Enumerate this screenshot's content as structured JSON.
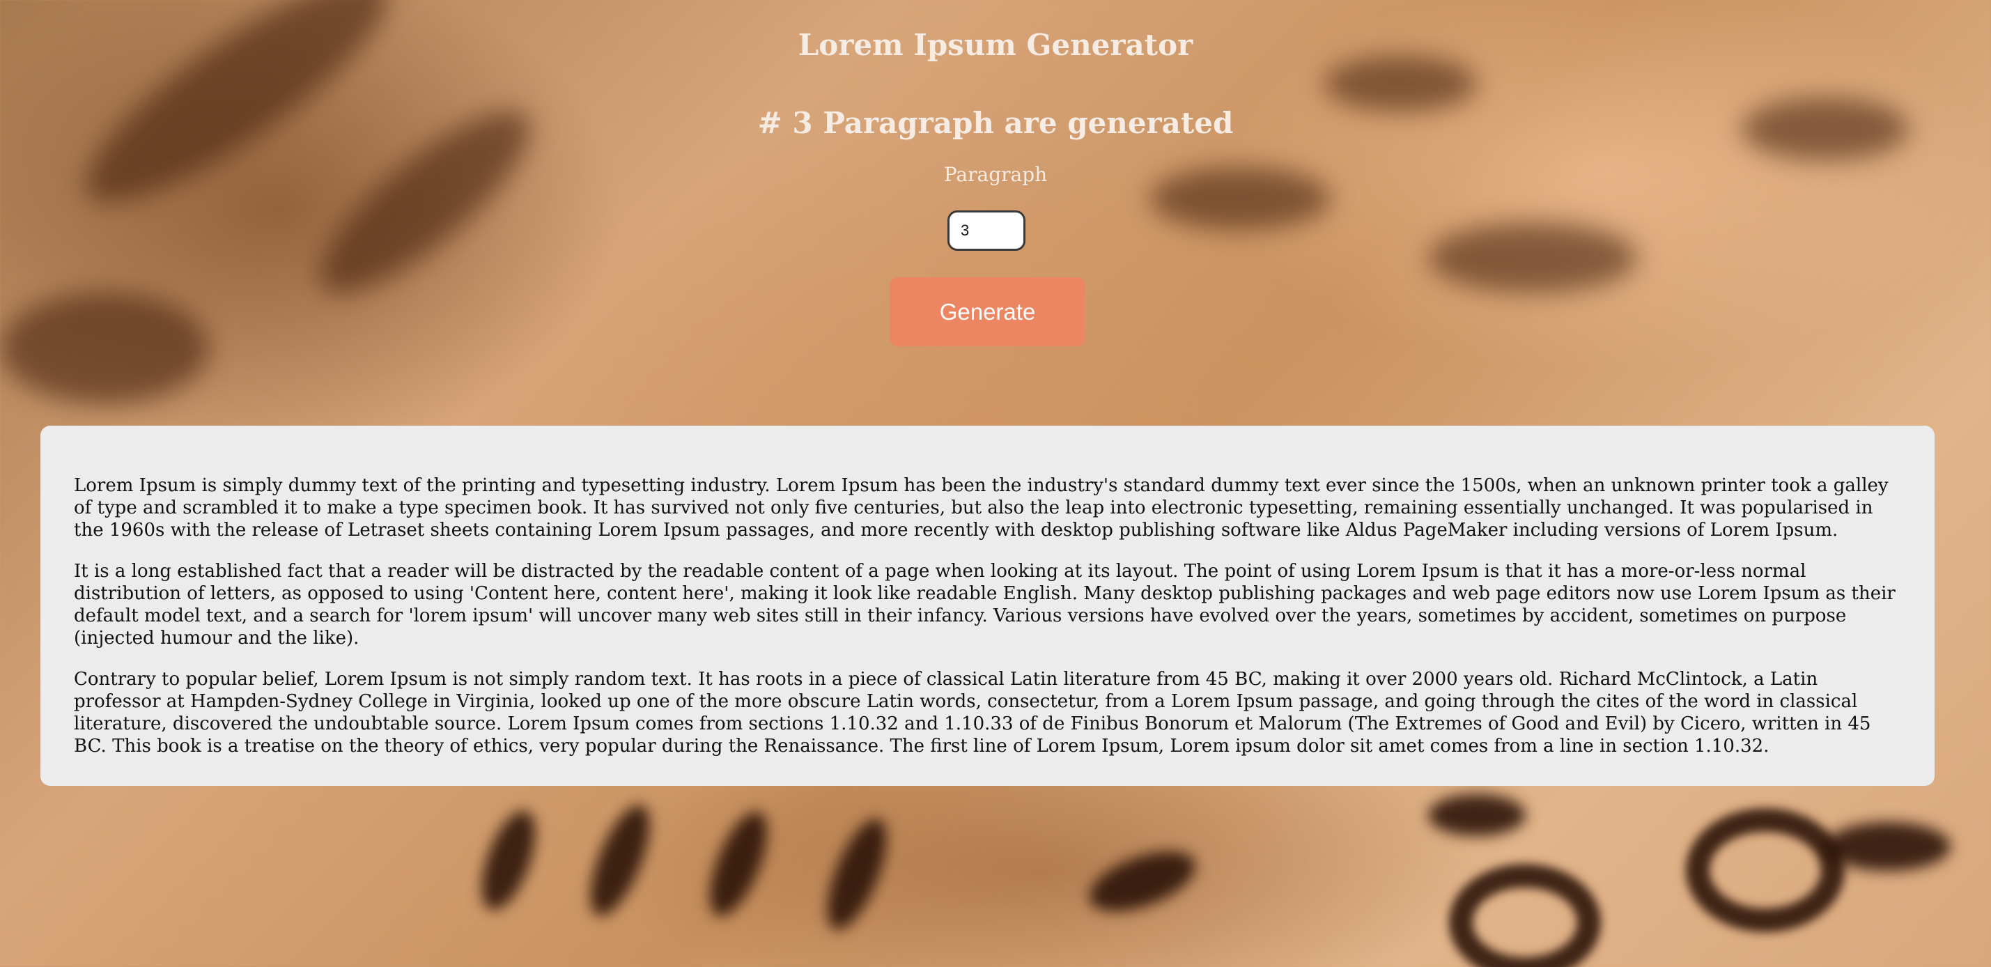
{
  "header": {
    "title": "Lorem Ipsum Generator",
    "status": "# 3 Paragraph are generated"
  },
  "form": {
    "label": "Paragraph",
    "count_value": "3",
    "generate_label": "Generate"
  },
  "output": {
    "paragraphs": [
      "Lorem Ipsum is simply dummy text of the printing and typesetting industry. Lorem Ipsum has been the industry's standard dummy text ever since the 1500s, when an unknown printer took a galley of type and scrambled it to make a type specimen book. It has survived not only five centuries, but also the leap into electronic typesetting, remaining essentially unchanged. It was popularised in the 1960s with the release of Letraset sheets containing Lorem Ipsum passages, and more recently with desktop publishing software like Aldus PageMaker including versions of Lorem Ipsum.",
      "It is a long established fact that a reader will be distracted by the readable content of a page when looking at its layout. The point of using Lorem Ipsum is that it has a more-or-less normal distribution of letters, as opposed to using 'Content here, content here', making it look like readable English. Many desktop publishing packages and web page editors now use Lorem Ipsum as their default model text, and a search for 'lorem ipsum' will uncover many web sites still in their infancy. Various versions have evolved over the years, sometimes by accident, sometimes on purpose (injected humour and the like).",
      "Contrary to popular belief, Lorem Ipsum is not simply random text. It has roots in a piece of classical Latin literature from 45 BC, making it over 2000 years old. Richard McClintock, a Latin professor at Hampden-Sydney College in Virginia, looked up one of the more obscure Latin words, consectetur, from a Lorem Ipsum passage, and going through the cites of the word in classical literature, discovered the undoubtable source. Lorem Ipsum comes from sections 1.10.32 and 1.10.33 of de Finibus Bonorum et Malorum (The Extremes of Good and Evil) by Cicero, written in 45 BC. This book is a treatise on the theory of ethics, very popular during the Renaissance. The first line of Lorem Ipsum, Lorem ipsum dolor sit amet comes from a line in section 1.10.32."
    ]
  },
  "theme": {
    "button_color": "#ec8561",
    "panel_color": "#ececec",
    "heading_color": "#f6ece4"
  }
}
